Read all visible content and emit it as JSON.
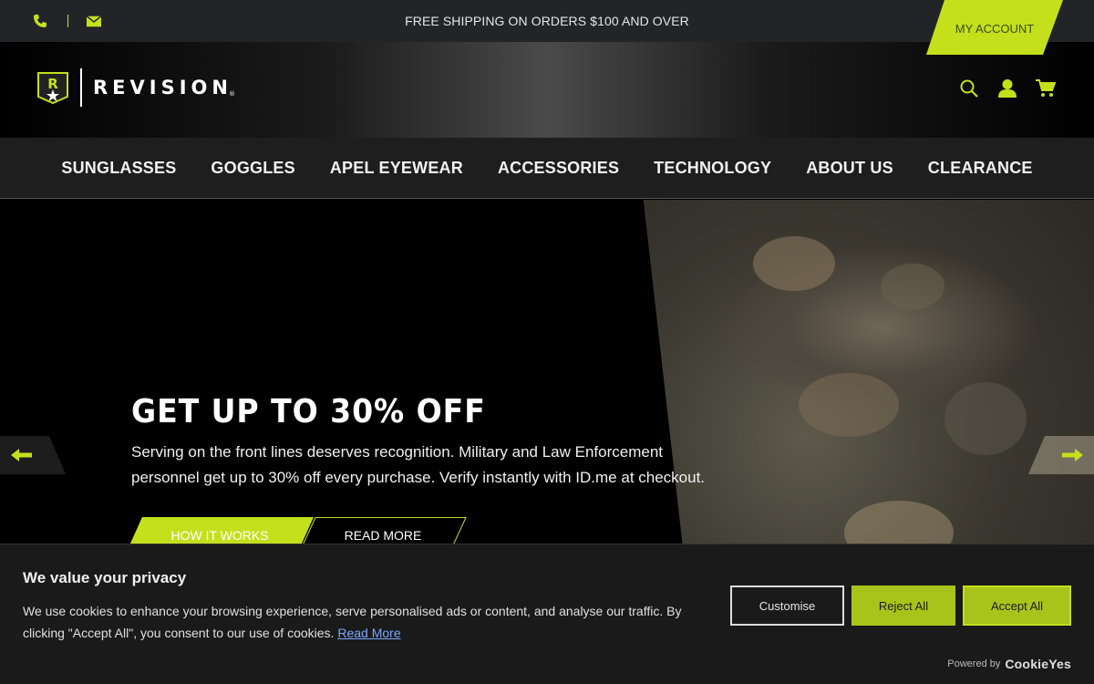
{
  "topbar": {
    "promo": "FREE SHIPPING ON ORDERS $100 AND OVER",
    "account_label": "MY ACCOUNT",
    "contact_icons": [
      "phone-icon",
      "mail-icon"
    ]
  },
  "header": {
    "brand": "REVISION",
    "brand_mark": "®",
    "icons": [
      "search-icon",
      "user-icon",
      "cart-icon"
    ]
  },
  "nav": {
    "items": [
      "SUNGLASSES",
      "GOGGLES",
      "APEL EYEWEAR",
      "ACCESSORIES",
      "TECHNOLOGY",
      "ABOUT US",
      "CLEARANCE"
    ]
  },
  "hero": {
    "title": "GET UP TO 30% OFF",
    "text": "Serving on the front lines deserves recognition. Military and Law Enforcement personnel get up to 30% off every purchase. Verify instantly with ID.me at checkout.",
    "primary_cta": "HOW IT WORKS",
    "secondary_cta": "READ MORE",
    "arrows": [
      "arrow-left-icon",
      "arrow-right-icon"
    ]
  },
  "cookie": {
    "title": "We value your privacy",
    "text": "We use cookies to enhance your browsing experience, serve personalised ads or content, and analyse our traffic. By clicking \"Accept All\", you consent to our use of cookies.",
    "link": "Read More",
    "customise": "Customise",
    "reject": "Reject All",
    "accept": "Accept All",
    "powered_by": "Powered by",
    "powered_brand": "CookieYes"
  },
  "colors": {
    "accent": "#c4e01c",
    "accent_dark": "#a8c41a",
    "topbar_bg": "#232427",
    "nav_bg": "#1e1e1e"
  }
}
